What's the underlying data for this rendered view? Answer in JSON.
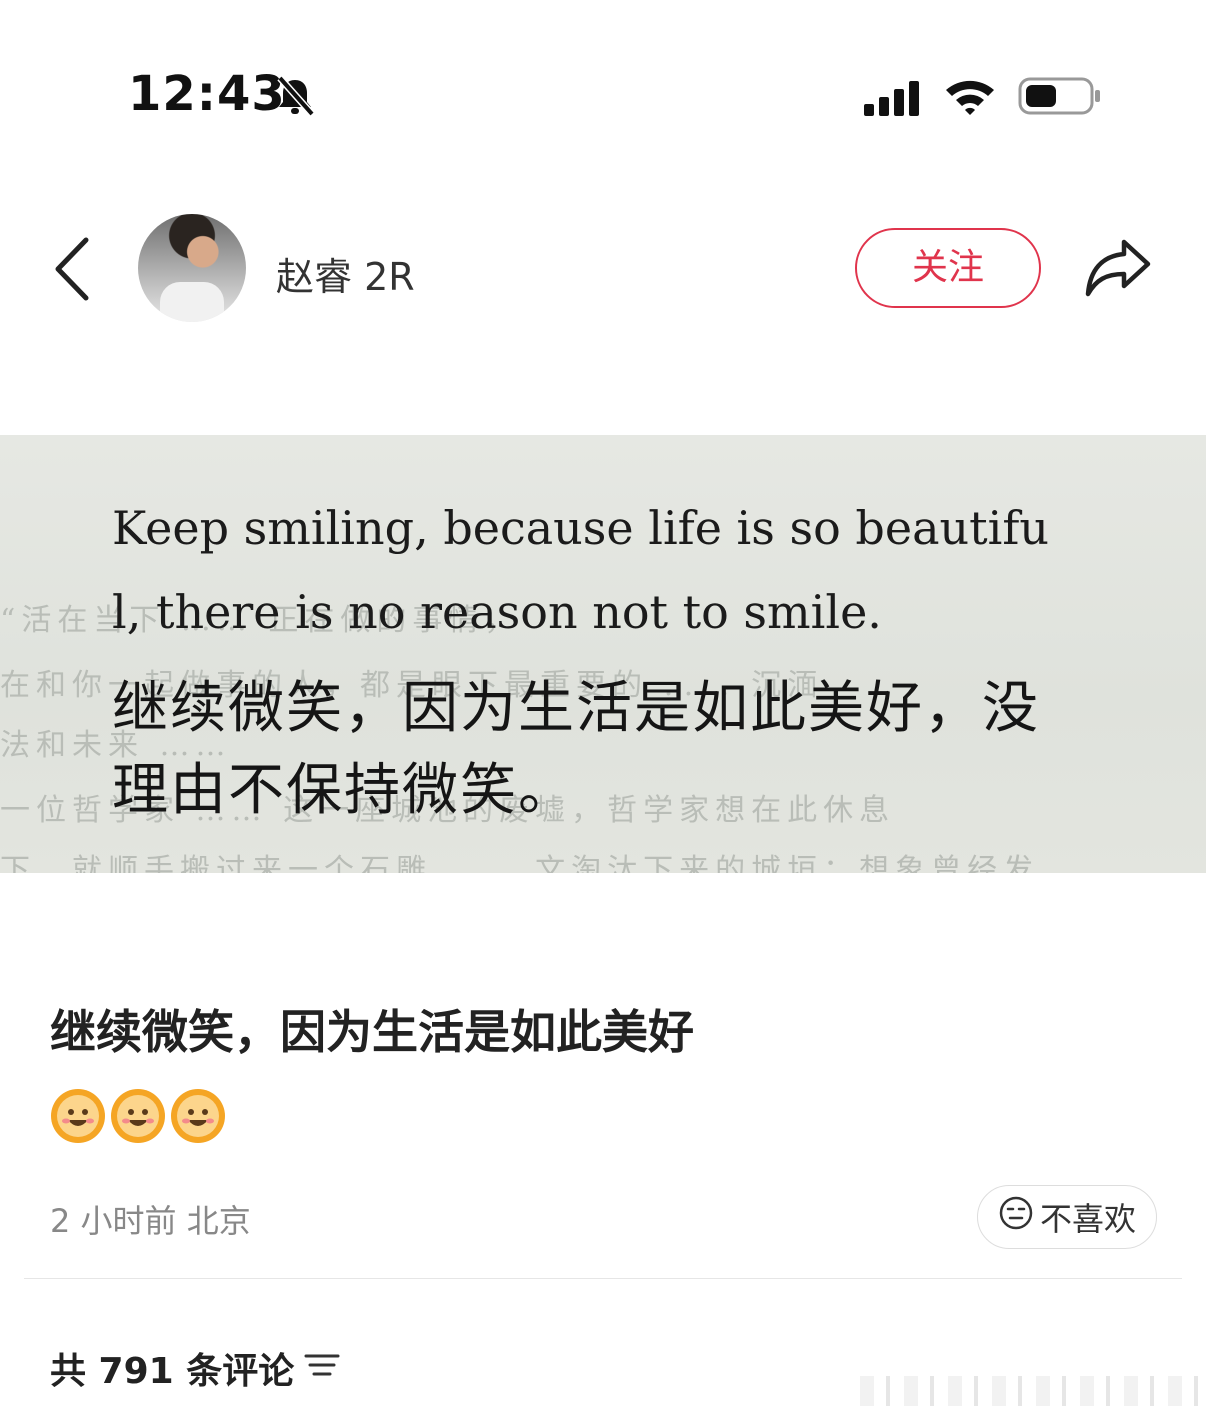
{
  "status_bar": {
    "time": "12:43",
    "icons": [
      "bell-slash-icon",
      "signal-icon",
      "wifi-icon",
      "battery-icon"
    ]
  },
  "header": {
    "author_name": "赵睿 2R",
    "follow_label": "关注",
    "icons": [
      "chevron-left-icon",
      "share-icon"
    ]
  },
  "post_image": {
    "english_line_1": "Keep smiling, because life is so beautifu",
    "english_line_2": "l, there is no reason not to smile.",
    "chinese_line_1": "继续微笑，因为生活是如此美好，没",
    "chinese_line_2": "理由不保持微笑。"
  },
  "post": {
    "title": "继续微笑，因为生活是如此美好",
    "emojis": [
      "sun-smile-emoji",
      "sun-smile-emoji",
      "sun-smile-emoji"
    ],
    "meta": "2 小时前  北京",
    "dislike_label": "不喜欢"
  },
  "comments": {
    "count_label": "共 791 条评论"
  },
  "colors": {
    "accent": "#e0344c",
    "meta_text": "#888888"
  }
}
